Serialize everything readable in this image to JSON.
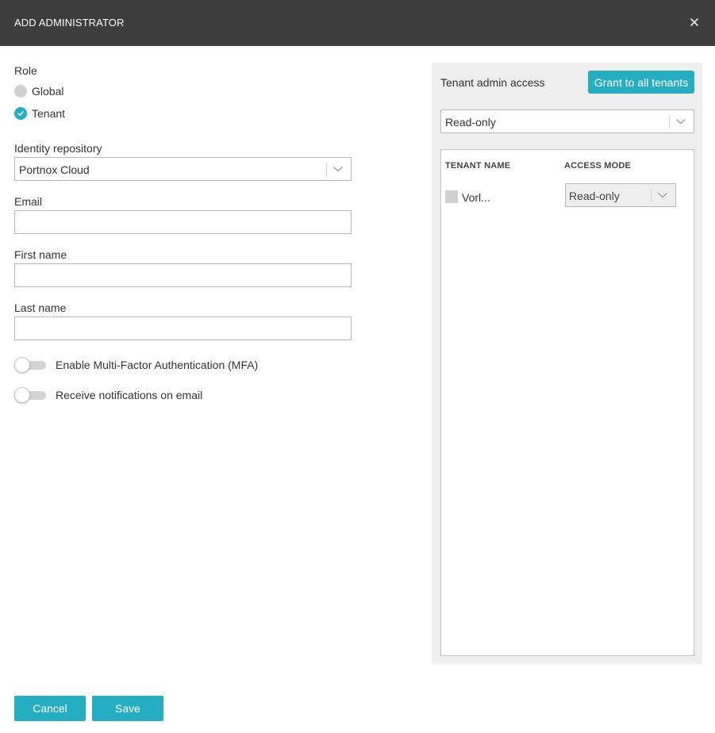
{
  "dialog": {
    "title": "ADD ADMINISTRATOR",
    "close_icon": "close-icon"
  },
  "form": {
    "role_label": "Role",
    "role_options": [
      {
        "label": "Global",
        "selected": false
      },
      {
        "label": "Tenant",
        "selected": true
      }
    ],
    "identity_repository_label": "Identity repository",
    "identity_repository_value": "Portnox Cloud",
    "email_label": "Email",
    "email_value": "",
    "first_name_label": "First name",
    "first_name_value": "",
    "last_name_label": "Last name",
    "last_name_value": "",
    "mfa_toggle_label": "Enable Multi-Factor Authentication (MFA)",
    "mfa_enabled": false,
    "notifications_toggle_label": "Receive notifications on email",
    "notifications_enabled": false
  },
  "tenant_access": {
    "title": "Tenant admin access",
    "grant_button_label": "Grant to all tenants",
    "default_access_value": "Read-only",
    "columns": [
      "TENANT NAME",
      "ACCESS MODE"
    ],
    "rows": [
      {
        "name": "Vorl...",
        "checked": false,
        "access_mode": "Read-only"
      }
    ]
  },
  "footer": {
    "cancel_label": "Cancel",
    "save_label": "Save"
  },
  "colors": {
    "header_bg": "#3e3e3e",
    "accent": "#25adc2",
    "panel_bg": "#eeeeee"
  }
}
